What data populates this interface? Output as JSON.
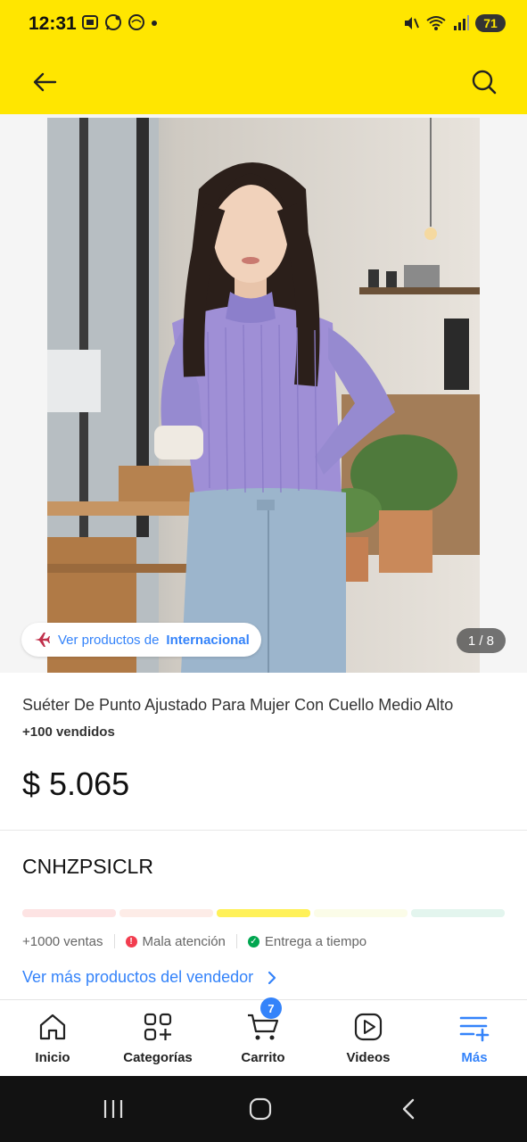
{
  "status_bar": {
    "time": "12:31",
    "battery": "71"
  },
  "top_bar": {
    "back_icon": "arrow-left-icon",
    "search_icon": "search-icon",
    "background": "#ffe600"
  },
  "gallery": {
    "badge_prefix": "Ver productos de",
    "badge_highlight": "Internacional",
    "counter": "1 / 8"
  },
  "product": {
    "title": "Suéter De Punto Ajustado Para Mujer Con Cuello Medio Alto",
    "sold": "+100 vendidos",
    "price": "$ 5.065"
  },
  "seller": {
    "name": "CNHZPSICLR",
    "reputation_colors": [
      "#fde3e3",
      "#fdece7",
      "#fff159",
      "#fbfce8",
      "#e3f5ee"
    ],
    "reputation_active_index": 2,
    "stats": [
      {
        "label": "+1000 ventas",
        "icon": ""
      },
      {
        "label": "Mala atención",
        "icon": "alert-icon",
        "color": "#f23d4f"
      },
      {
        "label": "Entrega a tiempo",
        "icon": "check-icon",
        "color": "#00a650"
      }
    ],
    "link": "Ver más productos del vendedor"
  },
  "bottom_nav": {
    "items": [
      {
        "label": "Inicio",
        "icon": "home-icon"
      },
      {
        "label": "Categorías",
        "icon": "categories-icon"
      },
      {
        "label": "Carrito",
        "icon": "cart-icon",
        "badge": "7"
      },
      {
        "label": "Videos",
        "icon": "play-video-icon"
      },
      {
        "label": "Más",
        "icon": "more-menu-icon",
        "active": true
      }
    ],
    "active_color": "#3483fa"
  },
  "colors": {
    "accent": "#3483fa",
    "brand_yellow": "#ffe600"
  }
}
